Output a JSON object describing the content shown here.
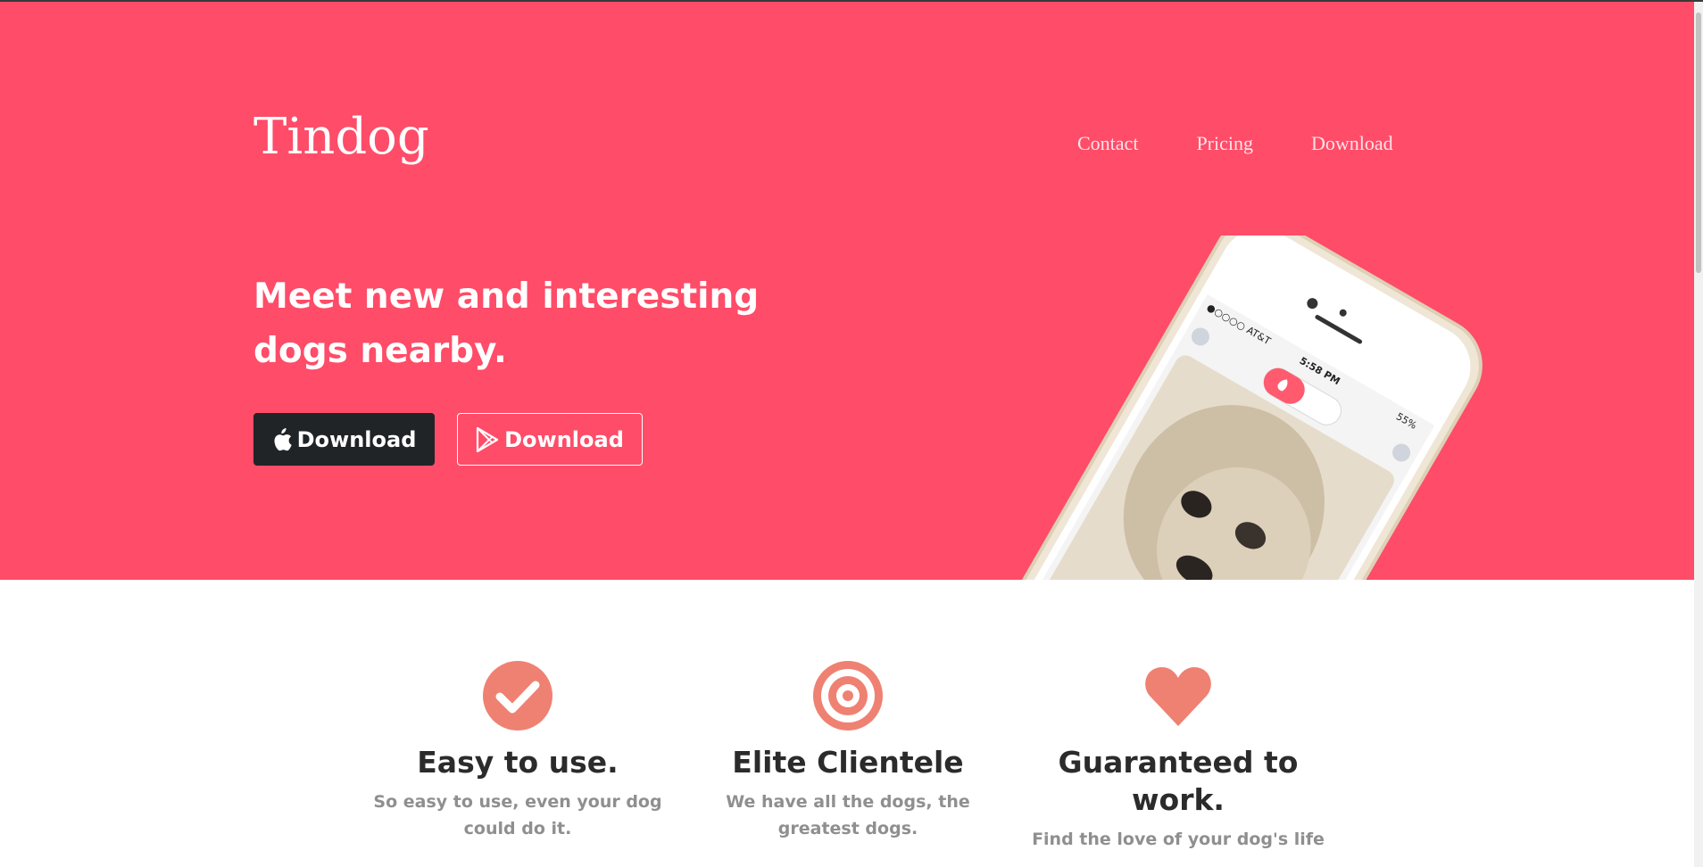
{
  "colors": {
    "hero_bg": "#ff4c68",
    "accent_icon": "#ef8172",
    "dark_button": "#202427"
  },
  "header": {
    "brand": "Tindog",
    "nav": [
      {
        "label": "Contact"
      },
      {
        "label": "Pricing"
      },
      {
        "label": "Download"
      }
    ]
  },
  "hero": {
    "headline": "Meet new and interesting dogs nearby.",
    "buttons": [
      {
        "label": "Download",
        "icon": "apple-icon"
      },
      {
        "label": "Download",
        "icon": "google-play-icon"
      }
    ],
    "phone": {
      "carrier": "●○○○○ AT&T",
      "time": "5:58 PM",
      "battery": "55%"
    }
  },
  "features": [
    {
      "icon": "check-circle-icon",
      "title": "Easy to use.",
      "text": "So easy to use, even your dog could do it."
    },
    {
      "icon": "bullseye-icon",
      "title": "Elite Clientele",
      "text": "We have all the dogs, the greatest dogs."
    },
    {
      "icon": "heart-icon",
      "title": "Guaranteed to work.",
      "text": "Find the love of your dog's life"
    }
  ]
}
